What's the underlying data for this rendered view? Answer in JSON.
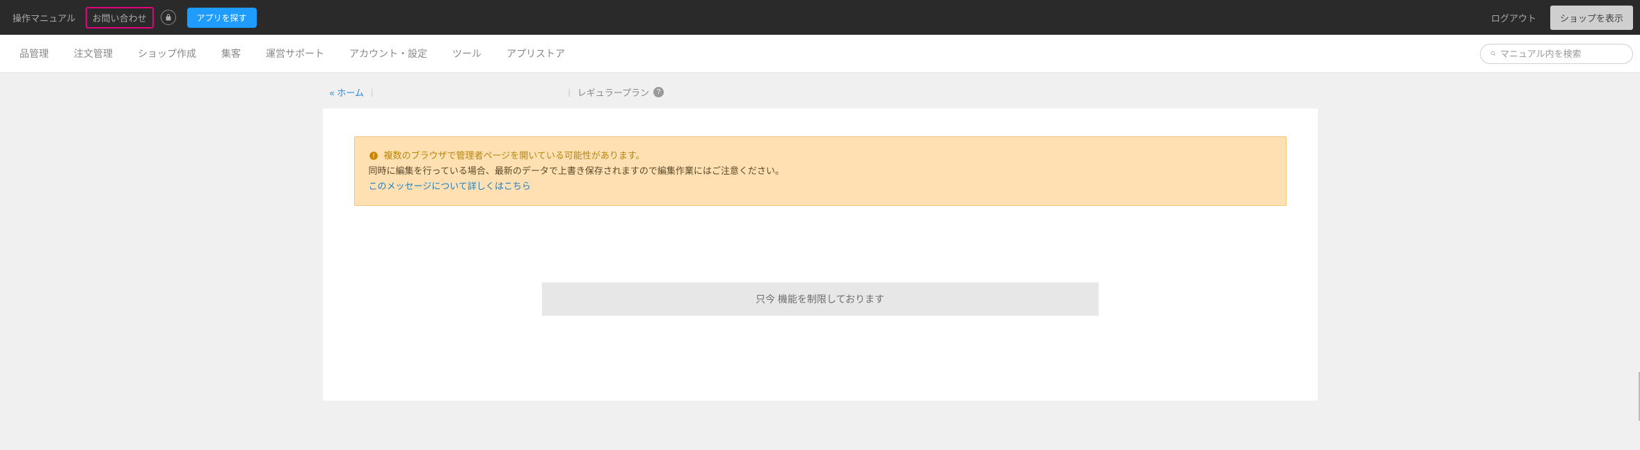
{
  "topbar": {
    "manual": "操作マニュアル",
    "contact": "お問い合わせ",
    "find_app": "アプリを探す",
    "logout": "ログアウト",
    "view_shop": "ショップを表示"
  },
  "nav": {
    "items": [
      "品管理",
      "注文管理",
      "ショップ作成",
      "集客",
      "運営サポート",
      "アカウント・設定",
      "ツール",
      "アプリストア"
    ],
    "search_placeholder": "マニュアル内を検索"
  },
  "crumb": {
    "home": "« ホーム",
    "plan": "レギュラープラン"
  },
  "alert": {
    "title": "複数のブラウザで管理者ページを開いている可能性があります。",
    "line2": "同時に編集を行っている場合、最新のデータで上書き保存されますので編集作業にはご注意ください。",
    "link": "このメッセージについて詳しくはこちら"
  },
  "restrict": {
    "text": "只今 機能を制限しております"
  }
}
